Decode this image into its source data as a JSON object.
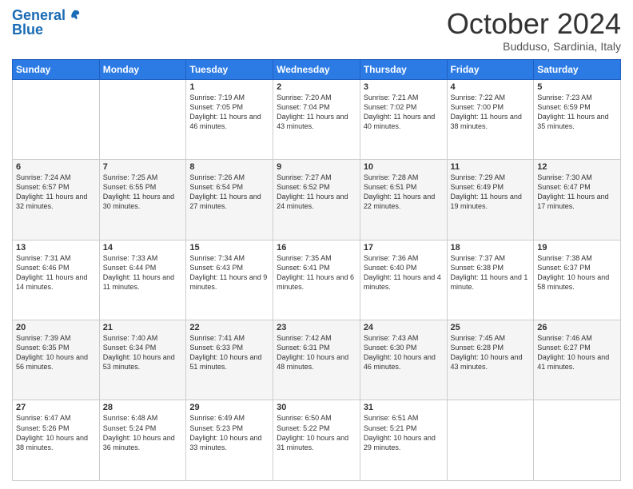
{
  "logo": {
    "line1": "General",
    "line2": "Blue"
  },
  "title": "October 2024",
  "location": "Budduso, Sardinia, Italy",
  "headers": [
    "Sunday",
    "Monday",
    "Tuesday",
    "Wednesday",
    "Thursday",
    "Friday",
    "Saturday"
  ],
  "weeks": [
    [
      {
        "day": "",
        "content": ""
      },
      {
        "day": "",
        "content": ""
      },
      {
        "day": "1",
        "content": "Sunrise: 7:19 AM\nSunset: 7:05 PM\nDaylight: 11 hours and 46 minutes."
      },
      {
        "day": "2",
        "content": "Sunrise: 7:20 AM\nSunset: 7:04 PM\nDaylight: 11 hours and 43 minutes."
      },
      {
        "day": "3",
        "content": "Sunrise: 7:21 AM\nSunset: 7:02 PM\nDaylight: 11 hours and 40 minutes."
      },
      {
        "day": "4",
        "content": "Sunrise: 7:22 AM\nSunset: 7:00 PM\nDaylight: 11 hours and 38 minutes."
      },
      {
        "day": "5",
        "content": "Sunrise: 7:23 AM\nSunset: 6:59 PM\nDaylight: 11 hours and 35 minutes."
      }
    ],
    [
      {
        "day": "6",
        "content": "Sunrise: 7:24 AM\nSunset: 6:57 PM\nDaylight: 11 hours and 32 minutes."
      },
      {
        "day": "7",
        "content": "Sunrise: 7:25 AM\nSunset: 6:55 PM\nDaylight: 11 hours and 30 minutes."
      },
      {
        "day": "8",
        "content": "Sunrise: 7:26 AM\nSunset: 6:54 PM\nDaylight: 11 hours and 27 minutes."
      },
      {
        "day": "9",
        "content": "Sunrise: 7:27 AM\nSunset: 6:52 PM\nDaylight: 11 hours and 24 minutes."
      },
      {
        "day": "10",
        "content": "Sunrise: 7:28 AM\nSunset: 6:51 PM\nDaylight: 11 hours and 22 minutes."
      },
      {
        "day": "11",
        "content": "Sunrise: 7:29 AM\nSunset: 6:49 PM\nDaylight: 11 hours and 19 minutes."
      },
      {
        "day": "12",
        "content": "Sunrise: 7:30 AM\nSunset: 6:47 PM\nDaylight: 11 hours and 17 minutes."
      }
    ],
    [
      {
        "day": "13",
        "content": "Sunrise: 7:31 AM\nSunset: 6:46 PM\nDaylight: 11 hours and 14 minutes."
      },
      {
        "day": "14",
        "content": "Sunrise: 7:33 AM\nSunset: 6:44 PM\nDaylight: 11 hours and 11 minutes."
      },
      {
        "day": "15",
        "content": "Sunrise: 7:34 AM\nSunset: 6:43 PM\nDaylight: 11 hours and 9 minutes."
      },
      {
        "day": "16",
        "content": "Sunrise: 7:35 AM\nSunset: 6:41 PM\nDaylight: 11 hours and 6 minutes."
      },
      {
        "day": "17",
        "content": "Sunrise: 7:36 AM\nSunset: 6:40 PM\nDaylight: 11 hours and 4 minutes."
      },
      {
        "day": "18",
        "content": "Sunrise: 7:37 AM\nSunset: 6:38 PM\nDaylight: 11 hours and 1 minute."
      },
      {
        "day": "19",
        "content": "Sunrise: 7:38 AM\nSunset: 6:37 PM\nDaylight: 10 hours and 58 minutes."
      }
    ],
    [
      {
        "day": "20",
        "content": "Sunrise: 7:39 AM\nSunset: 6:35 PM\nDaylight: 10 hours and 56 minutes."
      },
      {
        "day": "21",
        "content": "Sunrise: 7:40 AM\nSunset: 6:34 PM\nDaylight: 10 hours and 53 minutes."
      },
      {
        "day": "22",
        "content": "Sunrise: 7:41 AM\nSunset: 6:33 PM\nDaylight: 10 hours and 51 minutes."
      },
      {
        "day": "23",
        "content": "Sunrise: 7:42 AM\nSunset: 6:31 PM\nDaylight: 10 hours and 48 minutes."
      },
      {
        "day": "24",
        "content": "Sunrise: 7:43 AM\nSunset: 6:30 PM\nDaylight: 10 hours and 46 minutes."
      },
      {
        "day": "25",
        "content": "Sunrise: 7:45 AM\nSunset: 6:28 PM\nDaylight: 10 hours and 43 minutes."
      },
      {
        "day": "26",
        "content": "Sunrise: 7:46 AM\nSunset: 6:27 PM\nDaylight: 10 hours and 41 minutes."
      }
    ],
    [
      {
        "day": "27",
        "content": "Sunrise: 6:47 AM\nSunset: 5:26 PM\nDaylight: 10 hours and 38 minutes."
      },
      {
        "day": "28",
        "content": "Sunrise: 6:48 AM\nSunset: 5:24 PM\nDaylight: 10 hours and 36 minutes."
      },
      {
        "day": "29",
        "content": "Sunrise: 6:49 AM\nSunset: 5:23 PM\nDaylight: 10 hours and 33 minutes."
      },
      {
        "day": "30",
        "content": "Sunrise: 6:50 AM\nSunset: 5:22 PM\nDaylight: 10 hours and 31 minutes."
      },
      {
        "day": "31",
        "content": "Sunrise: 6:51 AM\nSunset: 5:21 PM\nDaylight: 10 hours and 29 minutes."
      },
      {
        "day": "",
        "content": ""
      },
      {
        "day": "",
        "content": ""
      }
    ]
  ]
}
